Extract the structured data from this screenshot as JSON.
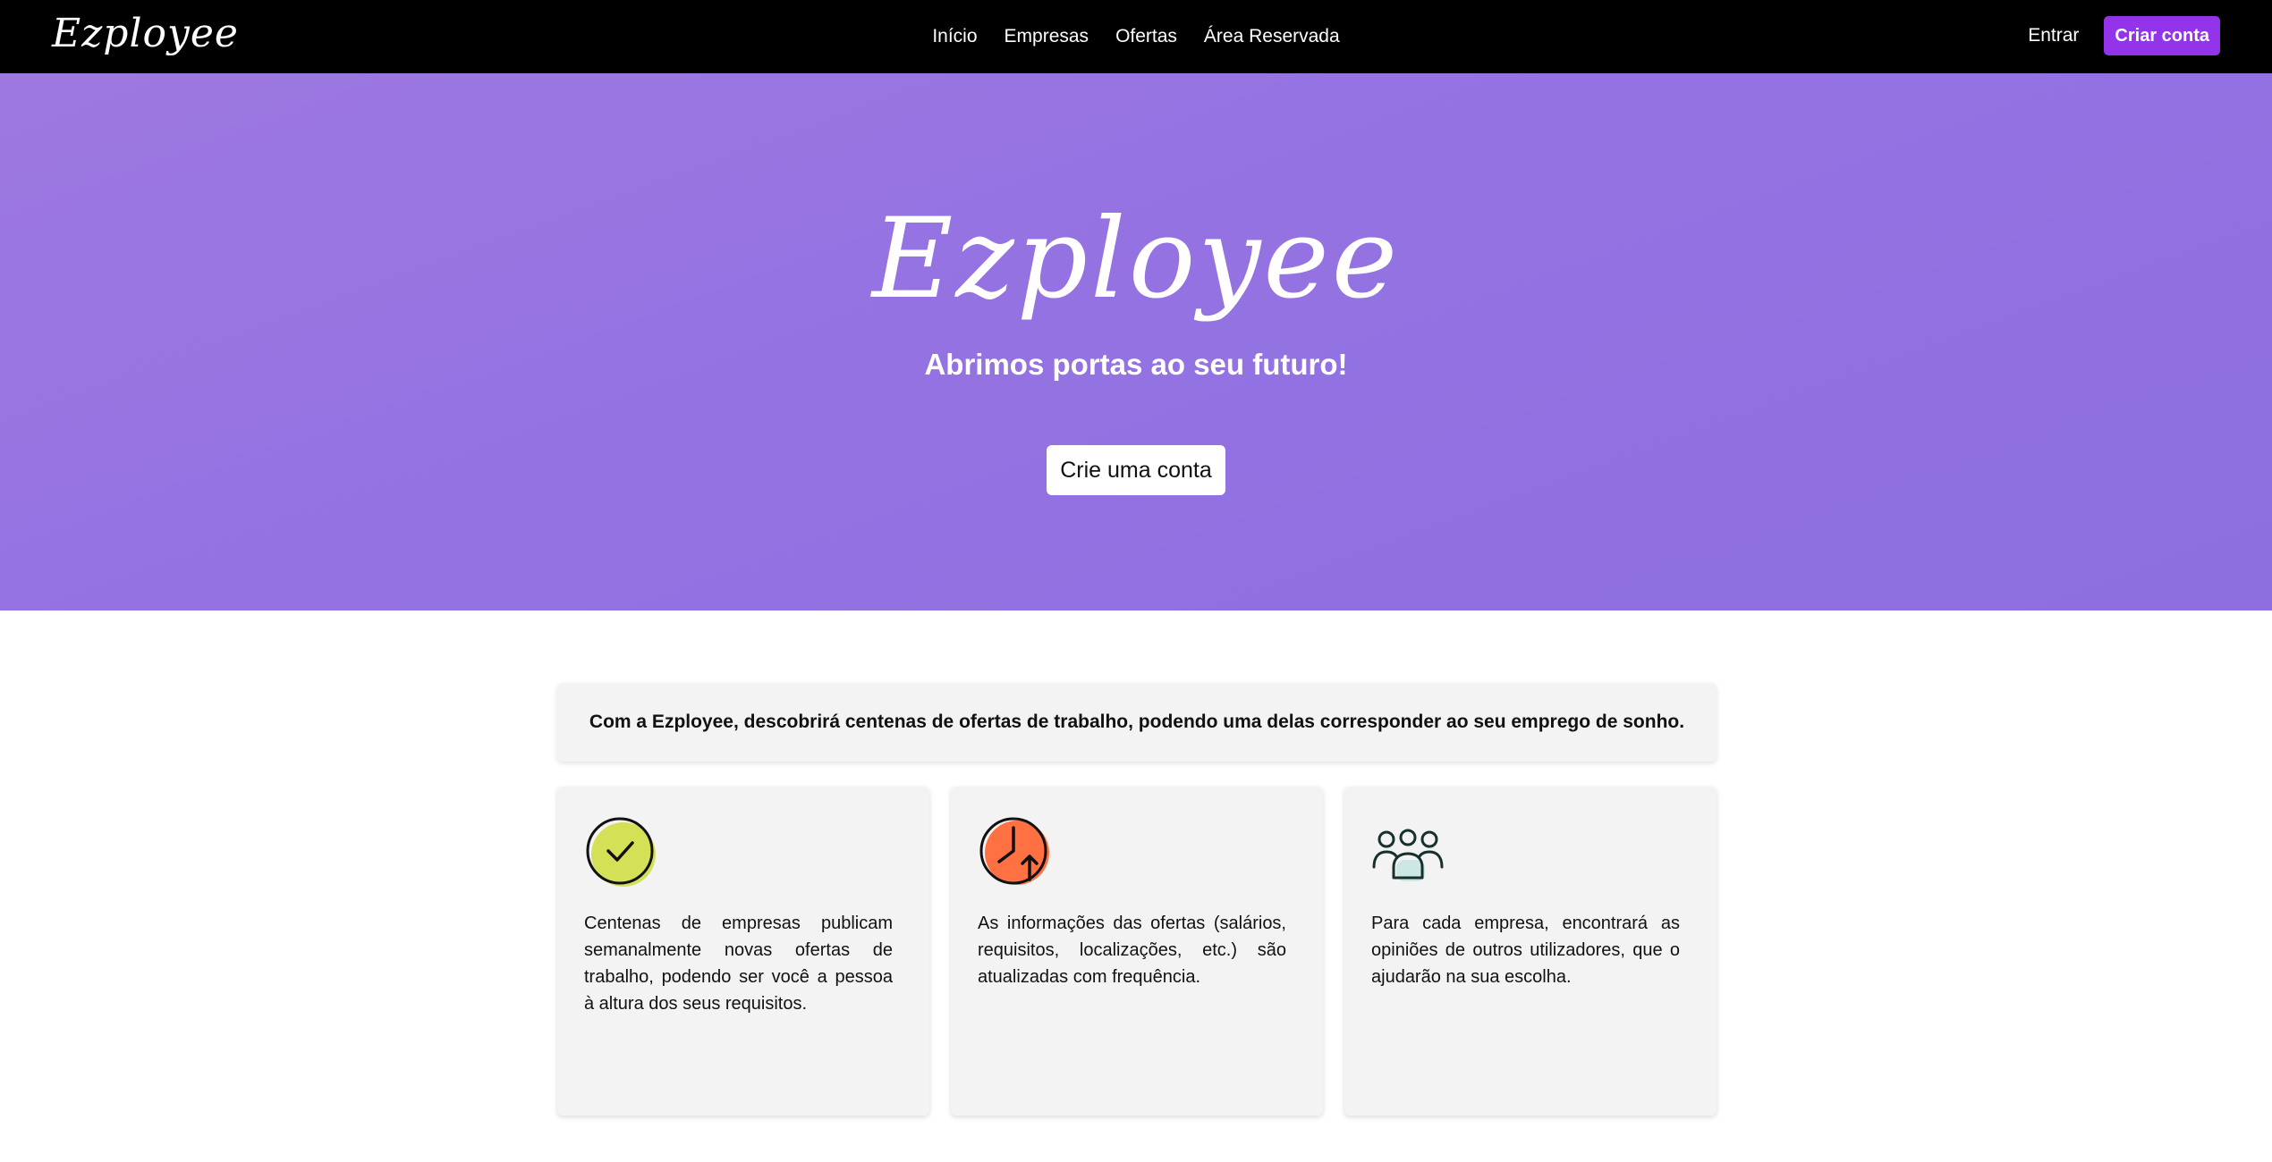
{
  "navbar": {
    "brand": "Ezployee",
    "links": [
      "Início",
      "Empresas",
      "Ofertas",
      "Área Reservada"
    ],
    "login_label": "Entrar",
    "signup_label": "Criar conta"
  },
  "hero": {
    "title": "Ezployee",
    "subtitle": "Abrimos portas ao seu futuro!",
    "cta_label": "Crie uma conta"
  },
  "intro": {
    "text": "Com a Ezployee, descobrirá centenas de ofertas de trabalho, podendo uma delas corresponder ao seu emprego de sonho."
  },
  "features": [
    {
      "icon": "check-circle-icon",
      "text": "Centenas de empresas publicam semanalmente novas ofertas de trabalho, podendo ser você a pessoa à altura dos seus requisitos."
    },
    {
      "icon": "clock-update-icon",
      "text": "As informações das ofertas (salários, requisitos, localizações, etc.) são atualizadas com frequência."
    },
    {
      "icon": "users-group-icon",
      "text": "Para cada empresa, encontrará as opiniões de outros utilizadores, que o ajudarão na sua escolha."
    }
  ],
  "colors": {
    "navbar_bg": "#000000",
    "accent": "#9333ea",
    "hero_bg": "#9473e1",
    "check_fill": "#d4e157",
    "clock_fill": "#ff7043",
    "users_fill": "#cde8e4"
  }
}
